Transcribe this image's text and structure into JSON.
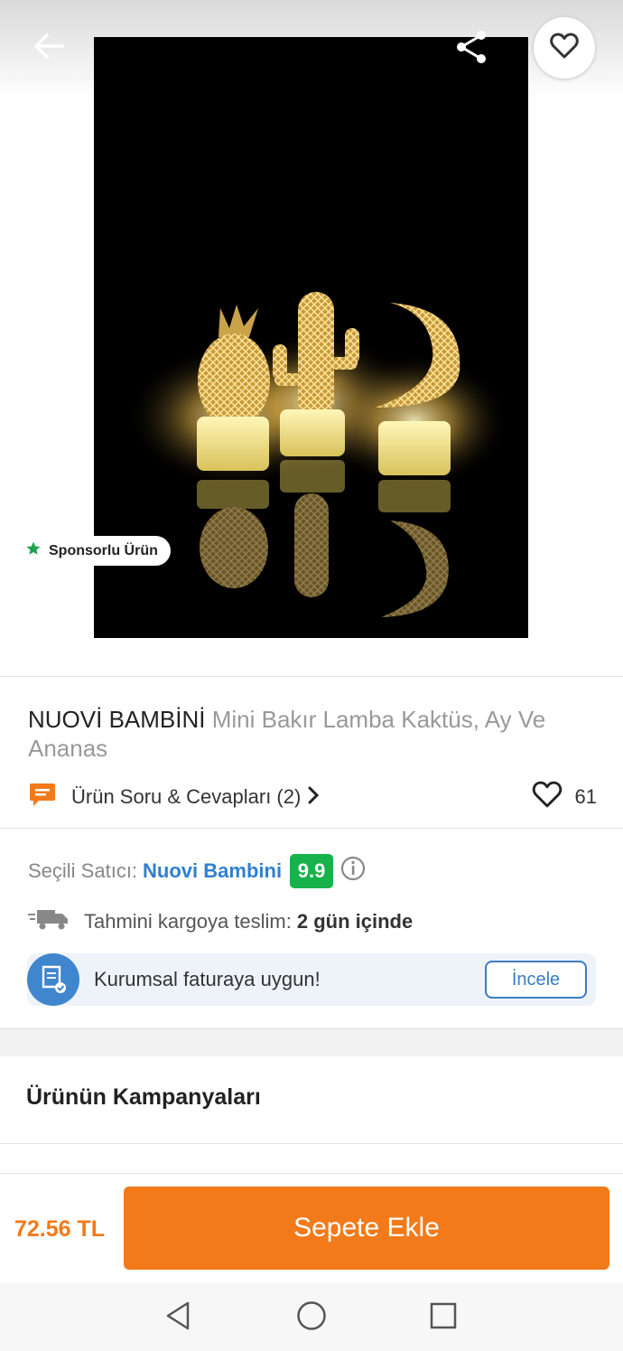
{
  "header": {
    "back_icon": "arrow-left-icon",
    "share_icon": "share-icon",
    "favorite_icon": "heart-outline-icon"
  },
  "image": {
    "sponsor_badge": "Sponsorlu Ürün",
    "sponsor_icon": "star-icon"
  },
  "product": {
    "brand": "NUOVİ BAMBİNİ",
    "name": " Mini Bakır Lamba Kaktüs, Ay Ve Ananas",
    "qa_label": "Ürün Soru & Cevapları (2)",
    "likes": "61"
  },
  "seller": {
    "label": "Seçili Satıcı:",
    "name": "Nuovi Bambini",
    "score": "9.9",
    "score_color": "#17b24a"
  },
  "shipping": {
    "label": "Tahmini kargoya teslim:",
    "value": "2 gün içinde"
  },
  "corporate": {
    "text": "Kurumsal faturaya uygun!",
    "button": "İncele"
  },
  "campaigns": {
    "title": "Ürünün Kampanyaları"
  },
  "cart": {
    "price": "72.56 TL",
    "button": "Sepete Ekle",
    "accent": "#f27a1a"
  },
  "system_nav": {
    "back": "triangle-back-icon",
    "home": "circle-home-icon",
    "recents": "square-recents-icon"
  }
}
